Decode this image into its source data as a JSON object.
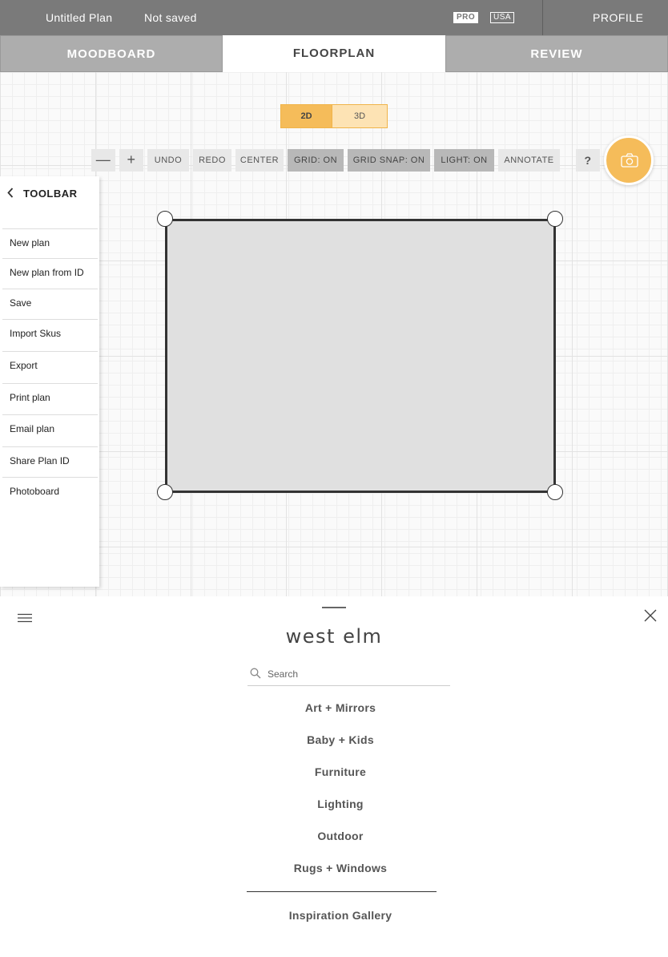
{
  "topbar": {
    "plan_name": "Untitled Plan",
    "save_status": "Not saved",
    "badge_pro": "PRO",
    "badge_usa": "USA",
    "profile": "PROFILE"
  },
  "tabs": [
    {
      "label": "MOODBOARD"
    },
    {
      "label": "FLOORPLAN"
    },
    {
      "label": "REVIEW"
    }
  ],
  "view_toggle": {
    "options": [
      "2D",
      "3D"
    ],
    "selected": "2D"
  },
  "toolbar_row": {
    "zoom_out": "—",
    "zoom_in": "+",
    "undo": "UNDO",
    "redo": "REDO",
    "center": "CENTER",
    "grid": "GRID: ON",
    "grid_snap": "GRID SNAP: ON",
    "light": "LIGHT: ON",
    "annotate": "ANNOTATE",
    "help": "?"
  },
  "side_toolbar": {
    "title": "TOOLBAR",
    "items": [
      "New plan",
      "New plan from ID",
      "Save",
      "Import Skus",
      "Export",
      "Print plan",
      "Email plan",
      "Share Plan ID",
      "Photoboard"
    ]
  },
  "catalog": {
    "brand": "west elm",
    "search_placeholder": "Search",
    "categories": [
      "Art + Mirrors",
      "Baby + Kids",
      "Furniture",
      "Lighting",
      "Outdoor",
      "Rugs + Windows"
    ],
    "inspiration": "Inspiration Gallery"
  },
  "colors": {
    "accent": "#f5bc5a",
    "topbar": "#7a7a7a",
    "inactive_tab": "#adadad"
  }
}
